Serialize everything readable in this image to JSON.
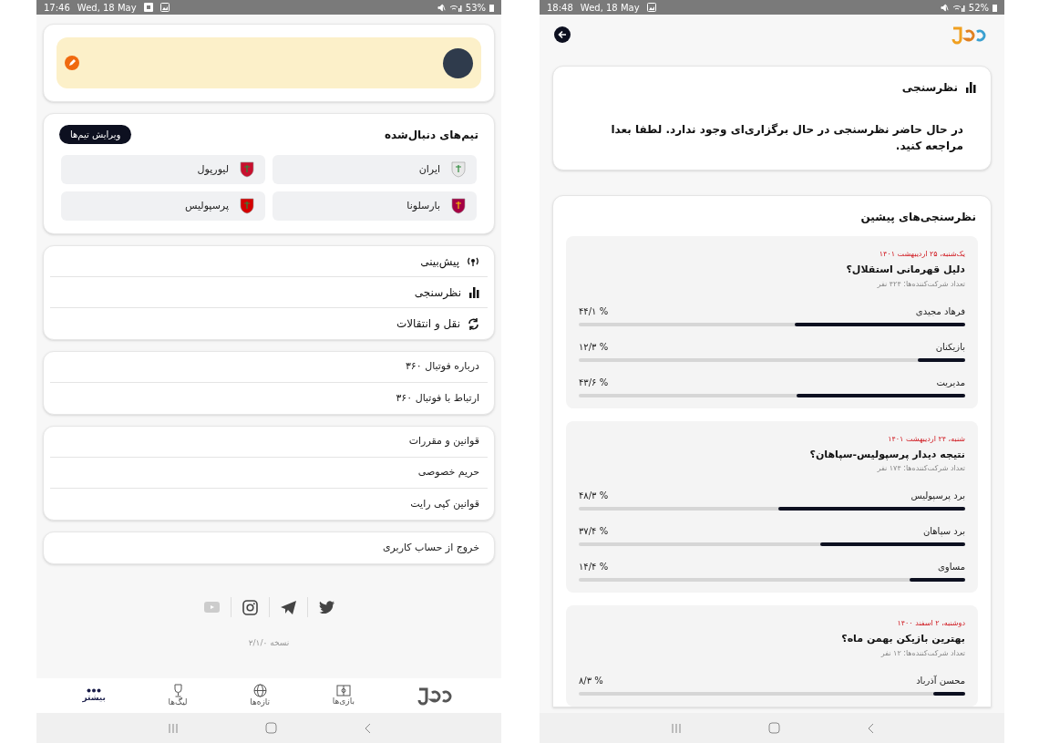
{
  "left_phone": {
    "status_bar": {
      "time": "17:46",
      "date": "Wed, 18 May",
      "battery": "53%"
    },
    "followed_teams": {
      "title": "تیم‌های دنبال‌شده",
      "edit_button": "ویرایش تیم‌ها",
      "teams": [
        {
          "name": "ایران"
        },
        {
          "name": "لیورپول"
        },
        {
          "name": "بارسلونا"
        },
        {
          "name": "پرسپولیس"
        }
      ]
    },
    "menu_groups": [
      [
        {
          "label": "پیش‌بینی",
          "kind": "icon"
        },
        {
          "label": "نظرسنجی",
          "kind": "icon"
        },
        {
          "label": "نقل و انتقالات",
          "kind": "icon"
        }
      ],
      [
        {
          "label": "درباره فوتبال ۳۶۰",
          "kind": "text"
        },
        {
          "label": "ارتباط با فوتبال ۳۶۰",
          "kind": "text"
        }
      ],
      [
        {
          "label": "قوانین و مقررات",
          "kind": "text"
        },
        {
          "label": "حریم خصوصی",
          "kind": "text"
        },
        {
          "label": "قوانین کپی رایت",
          "kind": "text"
        }
      ],
      [
        {
          "label": "خروج از حساب کاربری",
          "kind": "text"
        }
      ]
    ],
    "version": "نسخه ۲/۱/۰",
    "bottom_nav": [
      {
        "label": "بازی‌ها",
        "selected": false
      },
      {
        "label": "تازه‌ها",
        "selected": false
      },
      {
        "label": "لیگ‌ها",
        "selected": false
      },
      {
        "label": "بیشتر",
        "selected": true
      }
    ]
  },
  "right_phone": {
    "status_bar": {
      "time": "18:48",
      "date": "Wed, 18 May",
      "battery": "52%"
    },
    "current_poll": {
      "title": "نظرسنجی",
      "message": "در حال حاضر نظرسنجی در حال برگزاری‌ای وجود ندارد. لطفا بعدا مراجعه کنید."
    },
    "past_polls": {
      "title": "نظرسنجی‌های پیشین",
      "polls": [
        {
          "date": "یک‌شنبه، ۲۵ اردیبهشت ۱۴۰۱",
          "question": "دلیل قهرمانی استقلال؟",
          "participants": "تعداد شرکت‌کننده‌ها: ۴۲۴ نفر",
          "options": [
            {
              "label": "فرهاد مجیدی",
              "reading": "۴۴/۱ %",
              "level": 0.441
            },
            {
              "label": "بازیکنان",
              "reading": "۱۲/۳ %",
              "level": 0.123
            },
            {
              "label": "مدیریت",
              "reading": "۴۳/۶ %",
              "level": 0.436
            }
          ]
        },
        {
          "date": "شنبه، ۲۴ اردیبهشت ۱۴۰۱",
          "question": "نتیجه دیدار پرسپولیس-سپاهان؟",
          "participants": "تعداد شرکت‌کننده‌ها: ۱۷۴ نفر",
          "options": [
            {
              "label": "برد پرسپولیس",
              "reading": "۴۸/۳ %",
              "level": 0.483
            },
            {
              "label": "برد سپاهان",
              "reading": "۳۷/۴ %",
              "level": 0.374
            },
            {
              "label": "مساوی",
              "reading": "۱۴/۴ %",
              "level": 0.144
            }
          ]
        },
        {
          "date": "دوشنبه، ۲ اسفند ۱۴۰۰",
          "question": "بهترین بازیکن بهمن ماه؟",
          "participants": "تعداد شرکت‌کننده‌ها: ۱۲ نفر",
          "options": [
            {
              "label": "محسن آذرباد",
              "reading": "۸/۳ %",
              "level": 0.083
            }
          ]
        }
      ]
    }
  }
}
